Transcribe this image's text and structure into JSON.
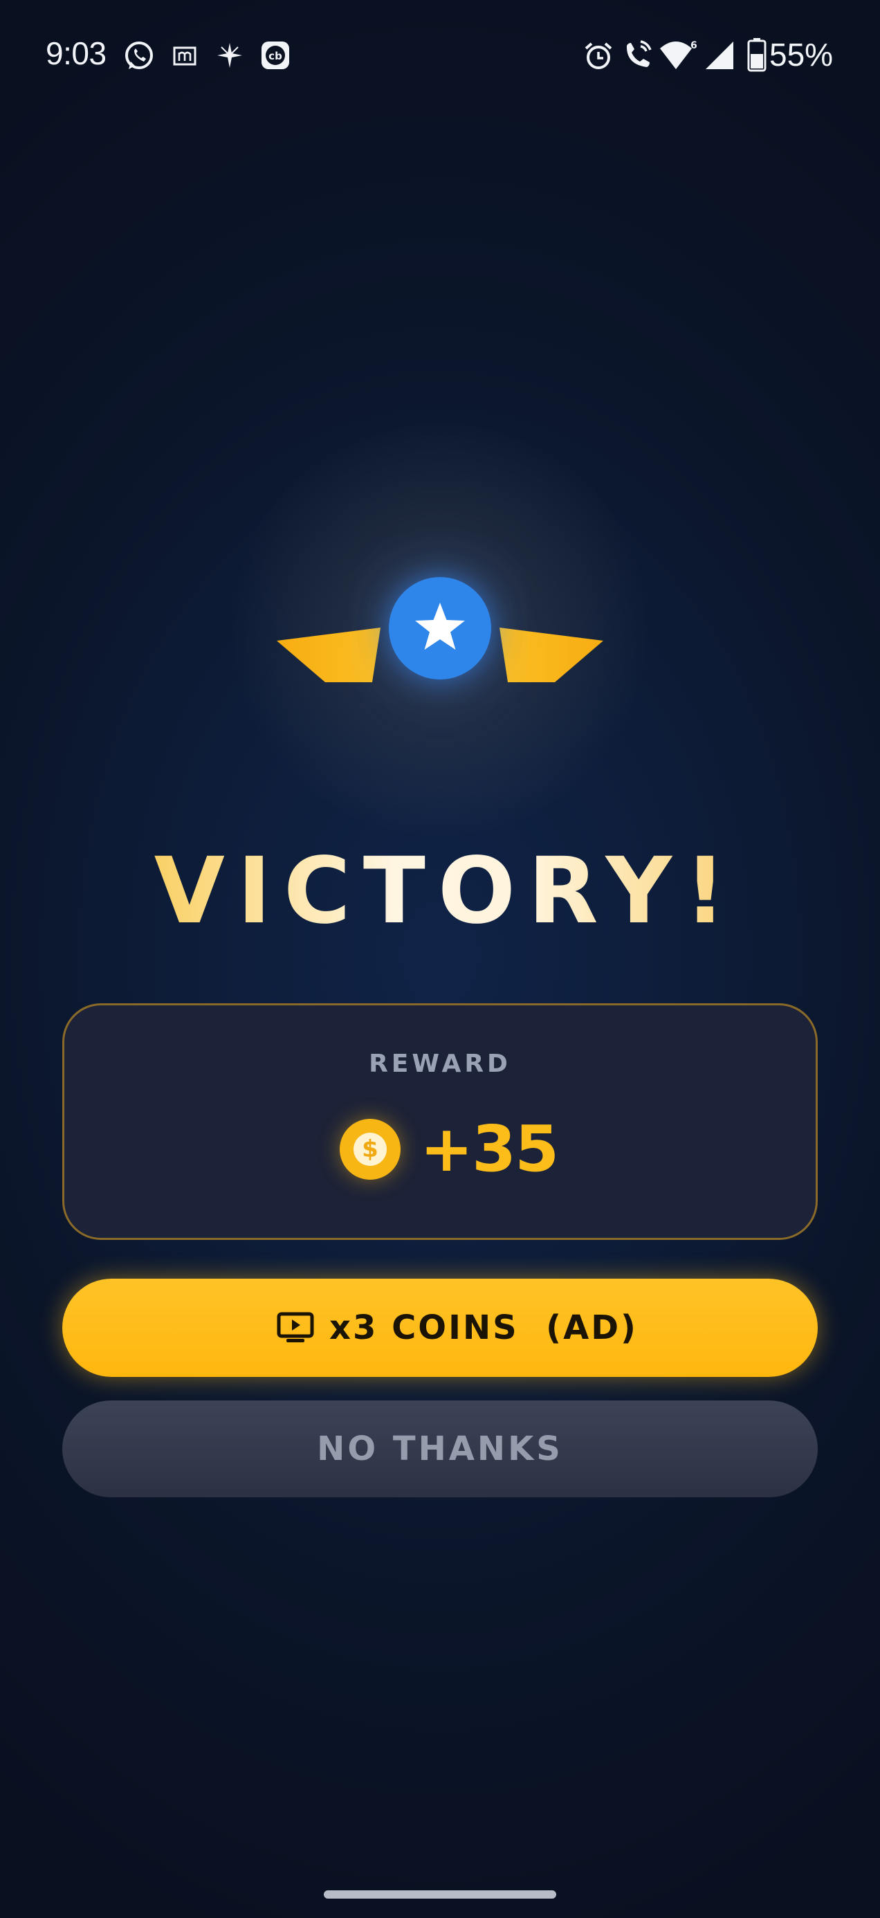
{
  "status_bar": {
    "time": "9:03",
    "battery_percent": "55%",
    "left_icons": [
      "whatsapp-icon",
      "m-app-icon",
      "sparkle-icon",
      "cb-app-icon"
    ],
    "right_icons": [
      "alarm-icon",
      "wifi-calling-icon",
      "wifi-6-icon",
      "cell-signal-icon",
      "battery-icon"
    ]
  },
  "emblem": {
    "icon": "star-icon",
    "circle_color": "#2f86ea",
    "wing_color": "#f8b614"
  },
  "title": "VICTORY!",
  "reward": {
    "label": "REWARD",
    "coin_icon": "dollar-coin-icon",
    "amount": "+35"
  },
  "buttons": {
    "ad_label": "x3 COINS  (AD)",
    "ad_icon": "tv-play-icon",
    "no_thanks_label": "NO THANKS"
  },
  "colors": {
    "accent_gold": "#fcbd1a",
    "background": "#0b1529",
    "card_border": "#8a6a28"
  }
}
